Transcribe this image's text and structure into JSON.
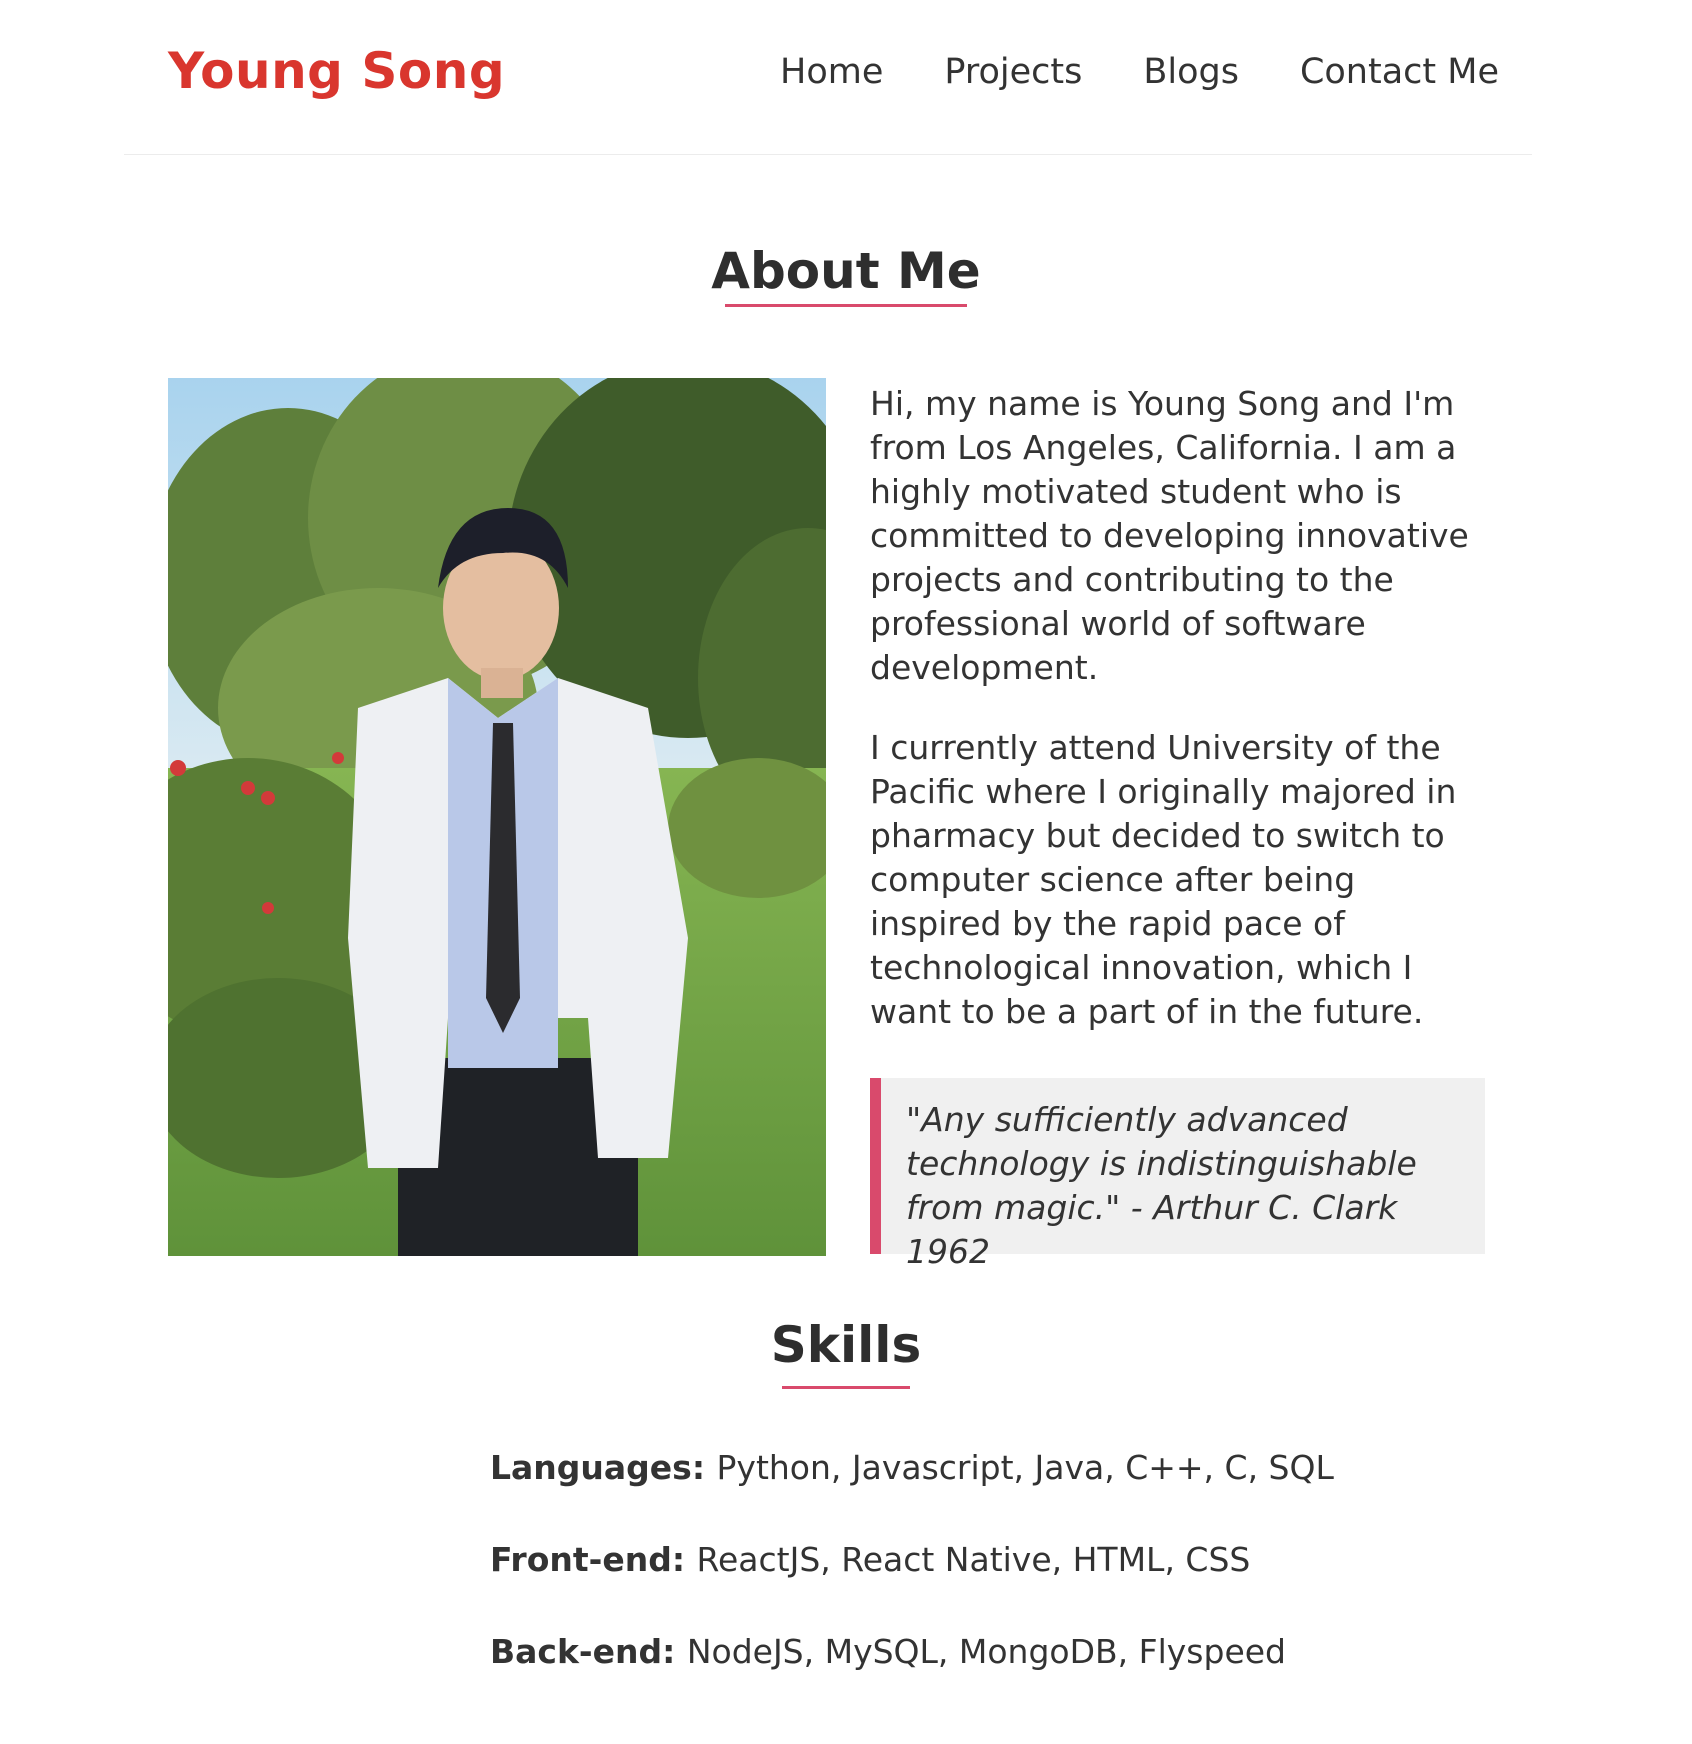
{
  "header": {
    "logo": "Young Song",
    "nav": [
      "Home",
      "Projects",
      "Blogs",
      "Contact Me"
    ]
  },
  "about": {
    "title": "About Me",
    "paragraphs": [
      "Hi, my name is Young Song and I'm from Los Angeles, California. I am a highly motivated student who is committed to developing innovative projects and contributing to the professional world of software development.",
      "I currently attend University of the Pacific where I originally majored in pharmacy but decided to switch to computer science after being inspired by the rapid pace of technological innovation, which I want to be a part of in the future."
    ],
    "quote": "\"Any sufficiently advanced technology is indistinguishable from magic.\" - Arthur C. Clark 1962",
    "photo_alt": "photo-of-young-song",
    "accent_color": "#d94a6c"
  },
  "skills": {
    "title": "Skills",
    "rows": [
      {
        "label": "Languages:",
        "value": "Python, Javascript, Java, C++, C, SQL"
      },
      {
        "label": "Front-end:",
        "value": "ReactJS, React Native, HTML, CSS"
      },
      {
        "label": "Back-end:",
        "value": "NodeJS, MySQL, MongoDB, Flyspeed"
      }
    ]
  },
  "colors": {
    "brand": "#d9362e",
    "accent": "#d94a6c",
    "text": "#2e2e2e",
    "quote_bg": "#f0f0f0"
  }
}
